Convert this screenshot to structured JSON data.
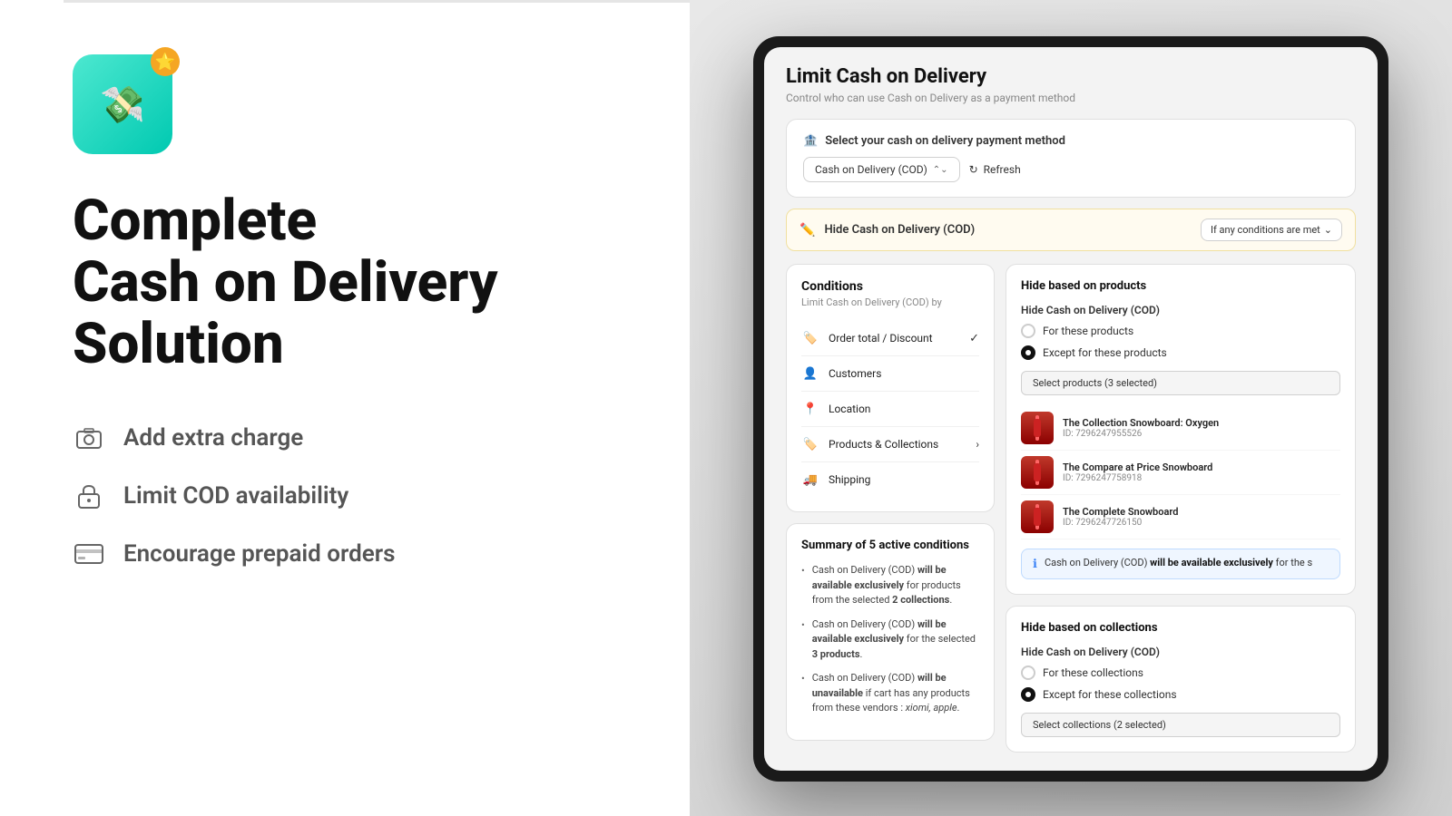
{
  "left": {
    "title_line1": "Complete",
    "title_line2": "Cash on Delivery",
    "title_line3": "Solution",
    "features": [
      {
        "id": "add-charge",
        "icon": "📷",
        "text": "Add extra charge"
      },
      {
        "id": "limit-cod",
        "icon": "🔒",
        "text": "Limit COD availability"
      },
      {
        "id": "prepaid",
        "icon": "💳",
        "text": "Encourage prepaid orders"
      }
    ],
    "star_emoji": "⭐"
  },
  "app": {
    "title": "Limit Cash on Delivery",
    "subtitle": "Control who can use Cash on Delivery as a payment method",
    "payment_method_label": "Select your cash on delivery payment method",
    "payment_method_icon": "🏦",
    "select_value": "Cash on Delivery (COD)",
    "refresh_label": "Refresh",
    "hide_cod_label": "Hide Cash on Delivery (COD)",
    "condition_dropdown_label": "If any conditions are met",
    "conditions_title": "Conditions",
    "conditions_subtitle": "Limit Cash on Delivery (COD) by",
    "conditions": [
      {
        "id": "order-total",
        "icon": "🏷️",
        "label": "Order total / Discount",
        "state": "checked"
      },
      {
        "id": "customers",
        "icon": "👤",
        "label": "Customers",
        "state": "normal"
      },
      {
        "id": "location",
        "icon": "📍",
        "label": "Location",
        "state": "normal"
      },
      {
        "id": "products-collections",
        "icon": "🏷️",
        "label": "Products & Collections",
        "state": "arrow"
      },
      {
        "id": "shipping",
        "icon": "🚚",
        "label": "Shipping",
        "state": "normal"
      }
    ],
    "summary_title": "Summary of 5 active conditions",
    "summary_items": [
      "Cash on Delivery (COD) will be available exclusively for products from the selected 2 collections.",
      "Cash on Delivery (COD) will be available exclusively for the selected 3 products.",
      "Cash on Delivery (COD) will be unavailable if cart has any products from these vendors : xiomi, apple."
    ],
    "hide_products_title": "Hide based on products",
    "hide_cod_products_label": "Hide Cash on Delivery (COD)",
    "radio_for_products": "For these products",
    "radio_except_products": "Except for these products",
    "select_products_btn": "Select products (3 selected)",
    "products": [
      {
        "id": "prod1",
        "name": "The Collection Snowboard: Oxygen",
        "sku": "ID: 7296247955526"
      },
      {
        "id": "prod2",
        "name": "The Compare at Price Snowboard",
        "sku": "ID: 7296247758918"
      },
      {
        "id": "prod3",
        "name": "The Complete Snowboard",
        "sku": "ID: 7296247726150"
      }
    ],
    "info_banner_text_prefix": "Cash on Delivery (COD)",
    "info_banner_bold": "will be available exclusively",
    "info_banner_suffix": "for the s",
    "hide_collections_title": "Hide based on collections",
    "hide_cod_collections_label": "Hide Cash on Delivery (COD)",
    "radio_for_collections": "For these collections",
    "radio_except_collections": "Except for these collections",
    "select_collections_btn": "Select collections (2 selected)"
  }
}
